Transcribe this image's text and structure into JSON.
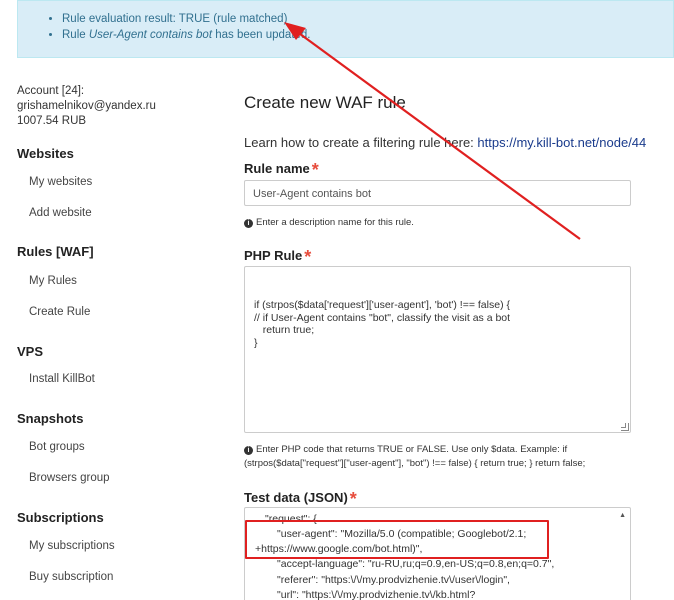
{
  "alert": {
    "line1": "Rule evaluation result: TRUE (rule matched)",
    "line2_prefix": "Rule ",
    "line2_em": "User-Agent contains bot",
    "line2_suffix": " has been updated."
  },
  "sidebar": {
    "account_line1": "Account [24]:",
    "account_line2": "grishamelnikov@yandex.ru",
    "account_line3": "1007.54 RUB",
    "sections": [
      {
        "title": "Websites",
        "items": [
          "My websites",
          "Add website"
        ]
      },
      {
        "title": "Rules [WAF]",
        "items": [
          "My Rules",
          "Create Rule"
        ]
      },
      {
        "title": "VPS",
        "items": [
          "Install KillBot"
        ]
      },
      {
        "title": "Snapshots",
        "items": [
          "Bot groups",
          "Browsers group"
        ]
      },
      {
        "title": "Subscriptions",
        "items": [
          "My subscriptions",
          "Buy subscription"
        ]
      }
    ]
  },
  "main": {
    "title": "Create new WAF rule",
    "learn_text": "Learn how to create a filtering rule here: ",
    "learn_link": "https://my.kill-bot.net/node/44",
    "rule_name_label": "Rule name",
    "rule_name_value": "User-Agent contains bot",
    "rule_name_help": "Enter a description name for this rule.",
    "php_rule_label": "PHP Rule",
    "php_code": "if (strpos($data['request']['user-agent'], 'bot') !== false) {\n// if User-Agent contains \"bot\", classify the visit as a bot\n   return true;\n}",
    "php_help_line1": "Enter PHP code that returns TRUE or FALSE. Use only $data. Example: if",
    "php_help_line2": "(strpos($data[\"request\"][\"user-agent\"], \"bot\") !== false) { return true; } return false;",
    "test_data_label": "Test data (JSON)",
    "json_lines": [
      "\"request\": {",
      "\"user-agent\": \"Mozilla/5.0 (compatible; Googlebot/2.1;",
      "+https://www.google.com/bot.html)\",",
      "\"accept-language\": \"ru-RU,ru;q=0.9,en-US;q=0.8,en;q=0.7\",",
      "\"referer\": \"https:\\/\\/my.prodvizhenie.tv\\/user\\/login\",",
      "\"url\": \"https:\\/\\/my.prodvizhenie.tv\\/kb.html?"
    ],
    "required_mark": "*",
    "info_glyph": "i"
  },
  "colors": {
    "alert_bg": "#d9edf7",
    "alert_text": "#31708f",
    "link": "#1a3b8c",
    "required": "#e74c3c",
    "annotation": "#e02020"
  }
}
